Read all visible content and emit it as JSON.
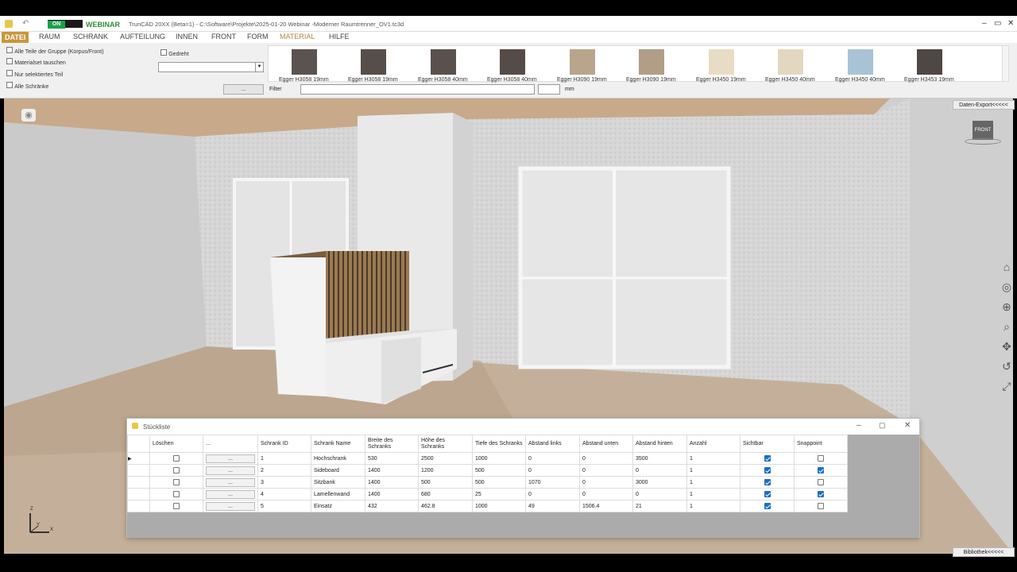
{
  "app": {
    "badge_on": "ON",
    "brand": "WEBINAR",
    "title": "TrunCAD 20XX (Beta=1)  - C:\\Software\\Projekte\\2025-01-20  Webinar -Moderner Raumtrenner_OV1.tc3d"
  },
  "menu": [
    "DATEI",
    "RAUM",
    "SCHRANK",
    "AUFTEILUNG",
    "INNEN",
    "FRONT",
    "FORM",
    "MATERIAL",
    "HILFE"
  ],
  "ribbon": {
    "checks": [
      "Alle Teile der Gruppe (Korpus/Front)",
      "Materialset tauschen",
      "Nur selektiertes Teil",
      "Alle Schränke"
    ],
    "rotated_label": "Gedreht",
    "combo_value": "",
    "dots_button": "...",
    "filter_label": "Filter",
    "filter_value": "",
    "size_value": "",
    "unit": "mm"
  },
  "swatches": [
    {
      "label": "Egger H3058 19mm",
      "color": "#5b5350"
    },
    {
      "label": "Egger H3058 19mm",
      "color": "#574e4a"
    },
    {
      "label": "Egger H3058 40mm",
      "color": "#5a514c"
    },
    {
      "label": "Egger H3058 40mm",
      "color": "#554c48"
    },
    {
      "label": "Egger H3090 19mm",
      "color": "#b9a48c"
    },
    {
      "label": "Egger H3090 19mm",
      "color": "#b29d86"
    },
    {
      "label": "Egger H3450 19mm",
      "color": "#e8dcc4"
    },
    {
      "label": "Egger H3450 40mm",
      "color": "#e4d7c0"
    },
    {
      "label": "Egger H3450 40mm",
      "color": "#a8c3d6"
    },
    {
      "label": "Egger H3453 19mm",
      "color": "#4f4744"
    }
  ],
  "hud": {
    "export": "Daten-Export<<<<<",
    "cube": "FRONT",
    "library": "Bibliothek<<<<<"
  },
  "axes": {
    "x": "X",
    "y": "Y",
    "z": "Z"
  },
  "stuckliste": {
    "title": "Stückliste",
    "columns": [
      "Löschen",
      "...",
      "Schrank ID",
      "Schrank Name",
      "Breite des Schranks",
      "Höhe des Schranks",
      "Tiefe des Schranks",
      "Abstand links",
      "Abstand unten",
      "Abstand hinten",
      "Anzahl",
      "Sichtbar",
      "Snappoint"
    ],
    "rows": [
      {
        "id": "1",
        "name": "Hochschrank",
        "breite": "530",
        "hoehe": "2500",
        "tiefe": "1000",
        "links": "0",
        "unten": "0",
        "hinten": "3500",
        "anzahl": "1",
        "sichtbar": true,
        "snap": false
      },
      {
        "id": "2",
        "name": "Sideboard",
        "breite": "1400",
        "hoehe": "1200",
        "tiefe": "500",
        "links": "0",
        "unten": "0",
        "hinten": "0",
        "anzahl": "1",
        "sichtbar": true,
        "snap": true
      },
      {
        "id": "3",
        "name": "Sitzbank",
        "breite": "1400",
        "hoehe": "500",
        "tiefe": "500",
        "links": "1070",
        "unten": "0",
        "hinten": "3000",
        "anzahl": "1",
        "sichtbar": true,
        "snap": false
      },
      {
        "id": "4",
        "name": "Lamellenwand",
        "breite": "1400",
        "hoehe": "680",
        "tiefe": "25",
        "links": "0",
        "unten": "0",
        "hinten": "0",
        "anzahl": "1",
        "sichtbar": true,
        "snap": true
      },
      {
        "id": "5",
        "name": "Einsatz",
        "breite": "432",
        "hoehe": "462.8",
        "tiefe": "1000",
        "links": "49",
        "unten": "1506.4",
        "hinten": "21",
        "anzahl": "1",
        "sichtbar": true,
        "snap": false
      }
    ],
    "dots": "..."
  }
}
